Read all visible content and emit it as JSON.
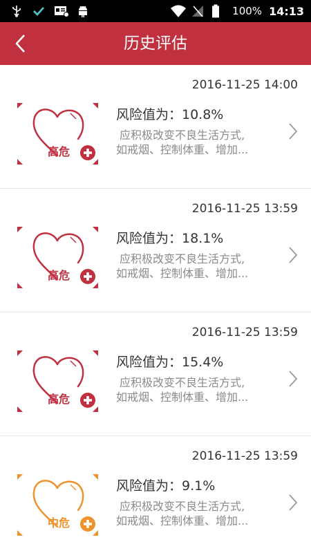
{
  "status_bar": {
    "time": "14:13",
    "battery": "100%",
    "icons": [
      "usb-icon",
      "check-icon",
      "id-card-icon",
      "android-icon",
      "wifi-icon",
      "no-signal-icon",
      "battery-icon"
    ]
  },
  "header": {
    "title": "历史评估",
    "back_icon": "chevron-left-icon"
  },
  "assessments": [
    {
      "timestamp": "2016-11-25 14:00",
      "risk_text": "风险值为：10.8%",
      "advice_line1": "应积极改变不良生活方式,",
      "advice_line2": "如戒烟、控制体重、增加...",
      "level_label": "高危",
      "level_color": "#c0303f"
    },
    {
      "timestamp": "2016-11-25 13:59",
      "risk_text": "风险值为：18.1%",
      "advice_line1": "应积极改变不良生活方式,",
      "advice_line2": "如戒烟、控制体重、增加...",
      "level_label": "高危",
      "level_color": "#c0303f"
    },
    {
      "timestamp": "2016-11-25 13:59",
      "risk_text": "风险值为：15.4%",
      "advice_line1": "应积极改变不良生活方式,",
      "advice_line2": "如戒烟、控制体重、增加...",
      "level_label": "高危",
      "level_color": "#c0303f"
    },
    {
      "timestamp": "2016-11-25 13:59",
      "risk_text": "风险值为：9.1%",
      "advice_line1": "应积极改变不良生活方式,",
      "advice_line2": "如戒烟、控制体重、增加...",
      "level_label": "中危",
      "level_color": "#f0922b"
    }
  ]
}
